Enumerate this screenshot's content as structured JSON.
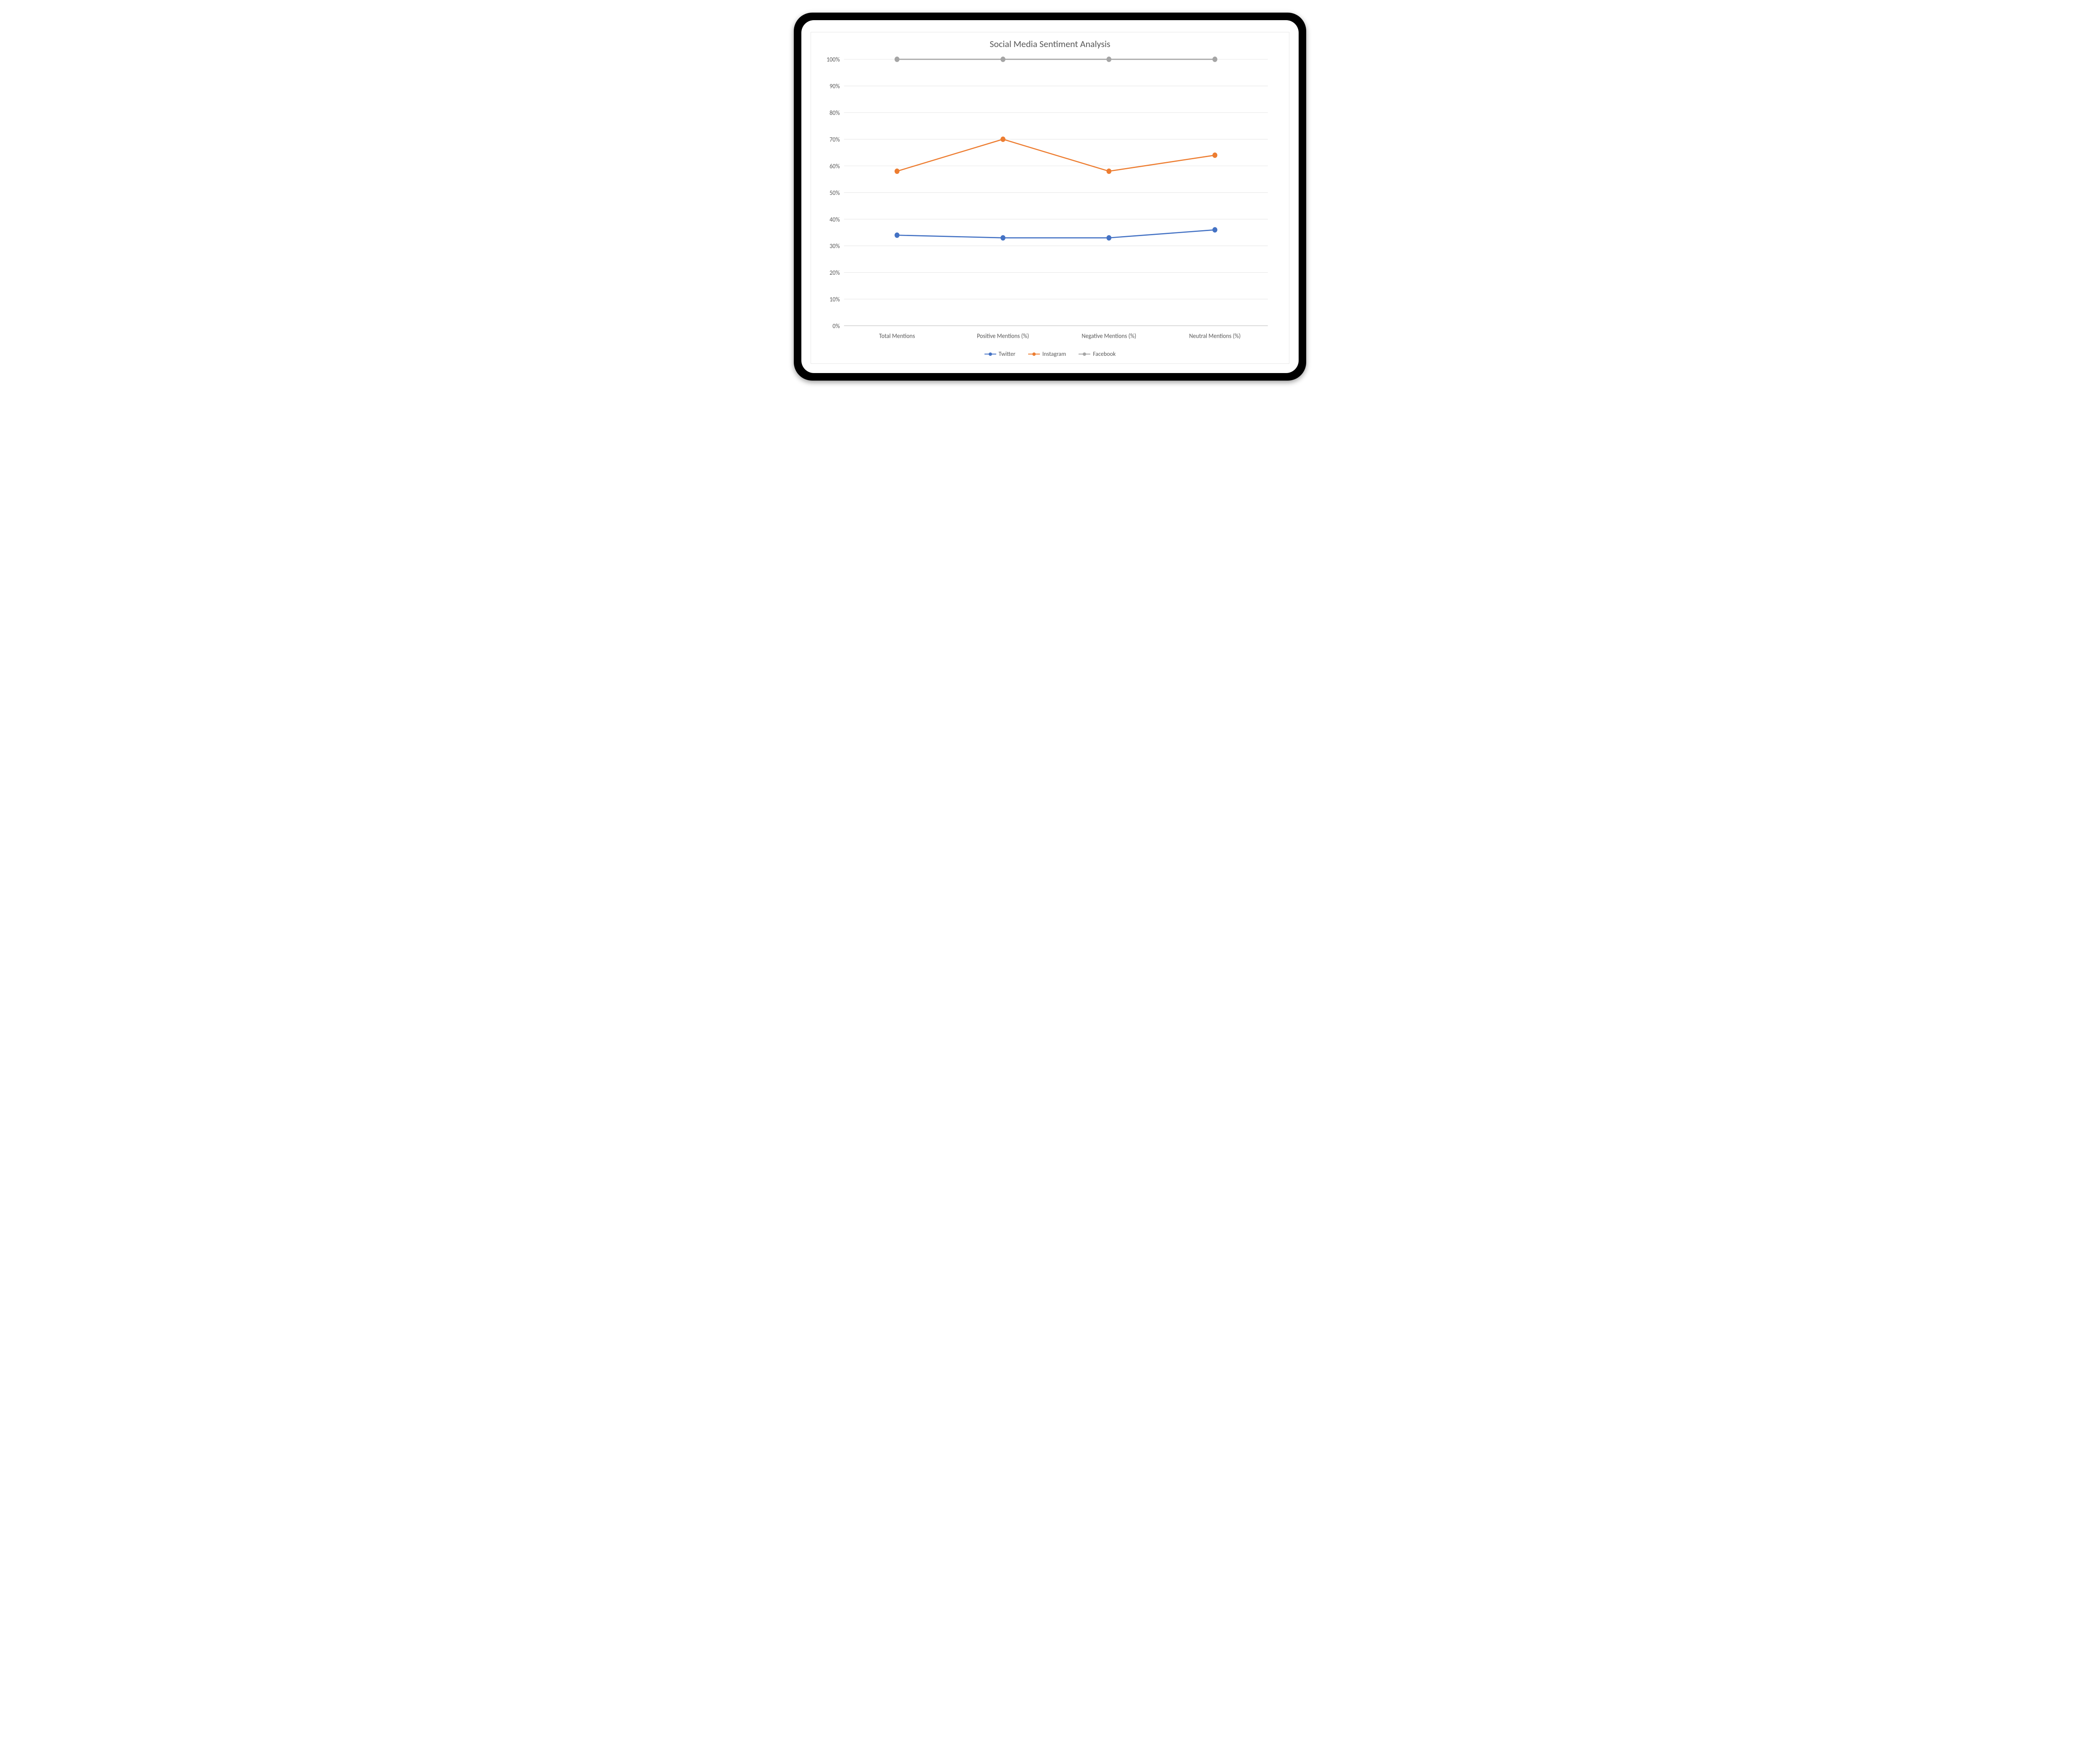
{
  "chart_data": {
    "type": "line",
    "title": "Social Media Sentiment Analysis",
    "xlabel": "",
    "ylabel": "",
    "ylim": [
      0,
      100
    ],
    "y_ticks": [
      0,
      10,
      20,
      30,
      40,
      50,
      60,
      70,
      80,
      90,
      100
    ],
    "y_tick_labels": [
      "0%",
      "10%",
      "20%",
      "30%",
      "40%",
      "50%",
      "60%",
      "70%",
      "80%",
      "90%",
      "100%"
    ],
    "y_tick_format": "percent",
    "categories": [
      "Total Mentions",
      "Positive Mentions (%)",
      "Negative Mentions (%)",
      "Neutral Mentions (%)"
    ],
    "series": [
      {
        "name": "Twitter",
        "color": "#4472C4",
        "values": [
          34,
          33,
          33,
          36
        ]
      },
      {
        "name": "Instagram",
        "color": "#ED7D31",
        "values": [
          58,
          70,
          58,
          64
        ]
      },
      {
        "name": "Facebook",
        "color": "#A5A5A5",
        "values": [
          100,
          100,
          100,
          100
        ]
      }
    ],
    "grid": true,
    "legend_position": "bottom"
  }
}
